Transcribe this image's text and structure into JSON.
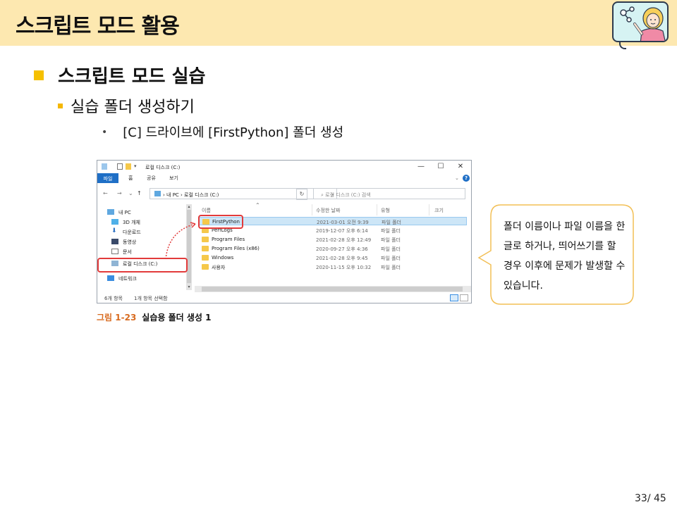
{
  "header": {
    "title": "스크립트 모드 활용"
  },
  "bullets": {
    "level1": "스크립트 모드 실습",
    "level2": "실습 폴더 생성하기",
    "level3": "[C] 드라이브에 [FirstPython] 폴더 생성"
  },
  "explorer": {
    "window_title": "로컬 디스크 (C:)",
    "controls": {
      "minimize": "—",
      "maximize": "☐",
      "close": "✕"
    },
    "ribbon_tabs": [
      "파일",
      "홈",
      "공유",
      "보기"
    ],
    "address": "›  내 PC  ›  로컬 디스크 (C:)",
    "search_placeholder": "로컬 디스크 (C:) 검색",
    "nav_items": [
      "내 PC",
      "3D 개체",
      "다운로드",
      "동영상",
      "문서",
      "로컬 디스크 (C:)",
      "네트워크"
    ],
    "columns": [
      "이름",
      "수정한 날짜",
      "유형",
      "크기"
    ],
    "files": [
      {
        "name": "FirstPython",
        "date": "2021-03-01 오전 9:39",
        "type": "파일 폴더"
      },
      {
        "name": "PerfLogs",
        "date": "2019-12-07 오후 6:14",
        "type": "파일 폴더"
      },
      {
        "name": "Program Files",
        "date": "2021-02-28 오후 12:49",
        "type": "파일 폴더"
      },
      {
        "name": "Program Files (x86)",
        "date": "2020-09-27 오후 4:36",
        "type": "파일 폴더"
      },
      {
        "name": "Windows",
        "date": "2021-02-28 오후 9:45",
        "type": "파일 폴더"
      },
      {
        "name": "사용자",
        "date": "2020-11-15 오후 10:32",
        "type": "파일 폴더"
      }
    ],
    "status_count": "6개 항목",
    "status_selected": "1개 항목 선택함",
    "colors": {
      "accent": "#1f6fc6",
      "folder": "#f5c84a",
      "highlight": "#e23b3b"
    }
  },
  "caption": {
    "number": "그림 1-23",
    "text": "실습용 폴더 생성 1"
  },
  "callout": {
    "text": "폴더 이름이나 파일 이름을 한글로 하거나, 띄어쓰기를 할 경우 이후에 문제가 발생할 수 있습니다.",
    "border_color": "#f2bf55"
  },
  "page": {
    "number": "33/ 45"
  }
}
